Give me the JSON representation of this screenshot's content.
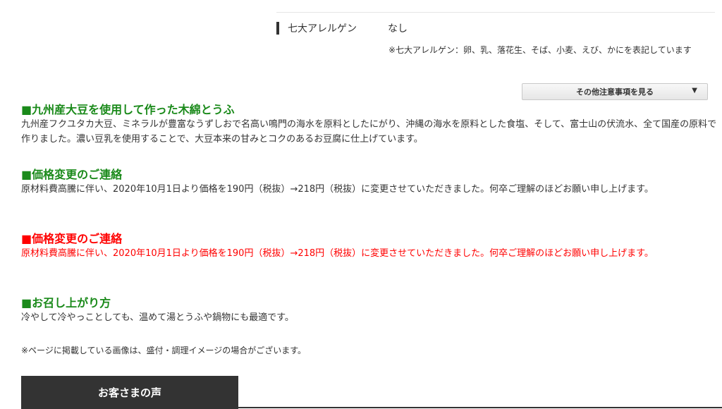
{
  "allergen": {
    "label": "七大アレルゲン",
    "value": "なし",
    "note": "※七大アレルゲン：卵、乳、落花生、そば、小麦、えび、かにを表記しています"
  },
  "more_button": {
    "label": "その他注意事項を見る",
    "arrow": "▼"
  },
  "sections": [
    {
      "title": "■九州産大豆を使用して作った木綿とうふ",
      "body": "九州産フクユタカ大豆、ミネラルが豊富なうずしおで名高い鳴門の海水を原料としたにがり、沖縄の海水を原料とした食塩、そして、富士山の伏流水、全て国産の原料で作りました。濃い豆乳を使用することで、大豆本来の甘みとコクのあるお豆腐に仕上げています。"
    },
    {
      "title": "■価格変更のご連絡",
      "body": "原材料費高騰に伴い、2020年10月1日より価格を190円（税抜）→218円（税抜）に変更させていただきました。何卒ご理解のほどお願い申し上げます。"
    },
    {
      "title": "■価格変更のご連絡",
      "body": "原材料費高騰に伴い、2020年10月1日より価格を190円（税抜）→218円（税抜）に変更させていただきました。何卒ご理解のほどお願い申し上げます。"
    },
    {
      "title": "■お召し上がり方",
      "body": "冷やして冷やっことしても、温めて湯とうふや鍋物にも最適です。"
    }
  ],
  "image_note": "※ページに掲載している画像は、盛付・調理イメージの場合がございます。",
  "voice_tab": {
    "label": "お客さまの声"
  },
  "colors": {
    "heading_green": "#1a8a1a",
    "notice_red": "#ff0000",
    "tab_dark": "#333333"
  }
}
